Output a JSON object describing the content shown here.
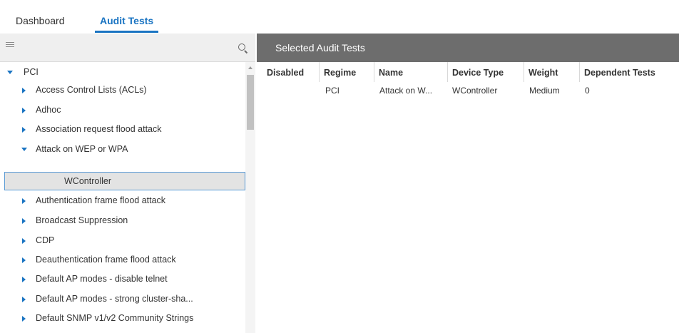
{
  "tabs": [
    {
      "label": "Dashboard",
      "active": false
    },
    {
      "label": "Audit Tests",
      "active": true
    }
  ],
  "left_panel": {
    "toolbar": {
      "menu_icon": "hamburger-icon",
      "search_icon": "search-icon"
    },
    "tree": {
      "root": "PCI",
      "items": [
        "Access Control Lists (ACLs)",
        "Adhoc",
        "Association request flood attack",
        "Attack on WEP or WPA",
        "WController",
        "Authentication frame flood attack",
        "Broadcast Suppression",
        "CDP",
        "Deauthentication frame flood attack",
        "Default AP modes - disable telnet",
        "Default AP modes - strong cluster-sha...",
        "Default SNMP v1/v2 Community Strings"
      ]
    }
  },
  "right_panel": {
    "header": "Selected Audit Tests",
    "columns": [
      "Disabled",
      "Regime",
      "Name",
      "Device Type",
      "Weight",
      "Dependent Tests"
    ],
    "rows": [
      {
        "disabled": "",
        "regime": "PCI",
        "name": "Attack on W...",
        "device_type": "WController",
        "weight": "Medium",
        "dependent_tests": "0"
      }
    ]
  },
  "colors": {
    "accent": "#1a74c2",
    "header_bg": "#6d6d6d",
    "selected_bg": "#e3e3e3",
    "selected_border": "#5b9bd5"
  }
}
